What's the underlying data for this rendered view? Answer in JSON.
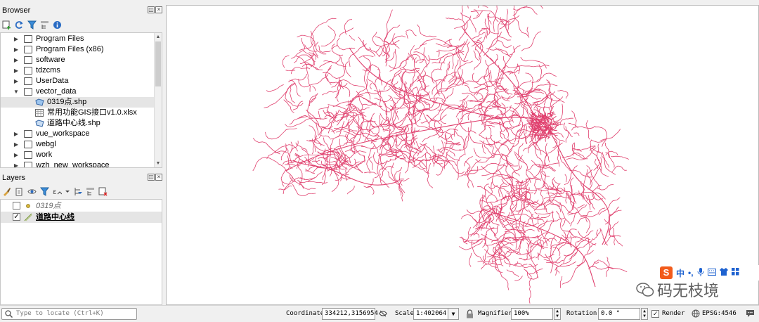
{
  "browser": {
    "title": "Browser",
    "toolbar_icons": [
      "add-selected-icon",
      "refresh-icon",
      "filter-icon",
      "collapse-all-icon",
      "properties-icon"
    ],
    "items": [
      {
        "label": "Program Files",
        "kind": "folder",
        "expanded": false
      },
      {
        "label": "Program Files (x86)",
        "kind": "folder",
        "expanded": false
      },
      {
        "label": "software",
        "kind": "folder",
        "expanded": false
      },
      {
        "label": "tdzcms",
        "kind": "folder",
        "expanded": false
      },
      {
        "label": "UserData",
        "kind": "folder",
        "expanded": false
      },
      {
        "label": "vector_data",
        "kind": "folder",
        "expanded": true
      },
      {
        "label": "0319点.shp",
        "kind": "shapefile",
        "selected": true
      },
      {
        "label": "常用功能GIS接口v1.0.xlsx",
        "kind": "spreadsheet"
      },
      {
        "label": "道路中心线.shp",
        "kind": "shapefile"
      },
      {
        "label": "vue_workspace",
        "kind": "folder",
        "expanded": false
      },
      {
        "label": "webgl",
        "kind": "folder",
        "expanded": false
      },
      {
        "label": "work",
        "kind": "folder",
        "expanded": false
      },
      {
        "label": "wzh_new_workspace",
        "kind": "folder",
        "expanded": false
      }
    ]
  },
  "layers": {
    "title": "Layers",
    "toolbar_icons": [
      "style-icon",
      "add-group-icon",
      "eye-icon",
      "filter-icon",
      "filter-expression-icon",
      "expand-all-icon",
      "collapse-all-icon",
      "remove-layer-icon"
    ],
    "items": [
      {
        "label": "0319点",
        "checked": false,
        "symbol": "point"
      },
      {
        "label": "道路中心线",
        "checked": true,
        "symbol": "line"
      }
    ]
  },
  "status": {
    "locate_placeholder": "Type to locate (Ctrl+K)",
    "coordinate_label": "Coordinate",
    "coordinate_value": "334212,3156954",
    "scale_label": "Scale",
    "scale_value": "1:402064",
    "magnifier_label": "Magnifier",
    "magnifier_value": "100%",
    "rotation_label": "Rotation",
    "rotation_value": "0.0 °",
    "render_label": "Render",
    "render_checked": true,
    "crs_label": "EPSG:4546"
  },
  "ime": {
    "logo": "S",
    "mode": "中"
  },
  "watermark": {
    "text": "码无枝境"
  },
  "colors": {
    "road": "#e0406e",
    "accent": "#1e62d0"
  }
}
